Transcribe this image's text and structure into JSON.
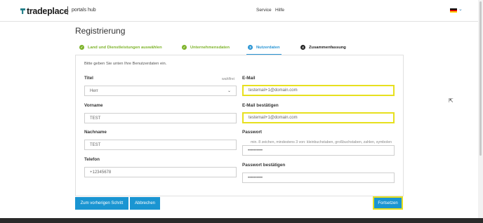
{
  "header": {
    "brand": "tradeplace",
    "hub": "portals hub",
    "nav": [
      "Service",
      "Hilfe"
    ],
    "language_icon": "germany-flag-icon"
  },
  "page": {
    "title": "Registrierung",
    "intro": "Bitte geben Sie unten Ihre Benutzerdaten ein."
  },
  "steps": [
    {
      "label": "Land und Dienstleistungen auswählen",
      "status": "done",
      "icon": "check-icon"
    },
    {
      "label": "Unternehmensdaten",
      "status": "done",
      "icon": "check-icon"
    },
    {
      "label": "Nutzerdaten",
      "status": "active",
      "number": "3"
    },
    {
      "label": "Zusammenfassung",
      "status": "pending",
      "number": "4"
    }
  ],
  "form": {
    "title": {
      "label": "Titel",
      "optional": "wahlfrei",
      "value": "Herr"
    },
    "first_name": {
      "label": "Vorname",
      "value": "TEST"
    },
    "last_name": {
      "label": "Nachname",
      "value": "TEST"
    },
    "phone": {
      "label": "Telefon",
      "value": "+12345678"
    },
    "email": {
      "label": "E-Mail",
      "value": "testemail+1@domain.com"
    },
    "email_confirm": {
      "label": "E-Mail bestätigen",
      "value": "testemail+1@domain.com"
    },
    "password": {
      "label": "Passwort",
      "hint": "min. 8 zeichen, mindestens 3 von: kleinbuchstaben, großbuchstaben, zahlen, symbolen",
      "value": "••••••••••"
    },
    "password_confirm": {
      "label": "Passwort bestätigen",
      "value": "••••••••••"
    }
  },
  "buttons": {
    "previous": "Zum vorherigen Schritt",
    "cancel": "Abbrechen",
    "next": "Fortsetzen"
  },
  "colors": {
    "accent_blue": "#1a95d2",
    "done_green": "#7db32a",
    "highlight_yellow": "#e7e01f"
  }
}
